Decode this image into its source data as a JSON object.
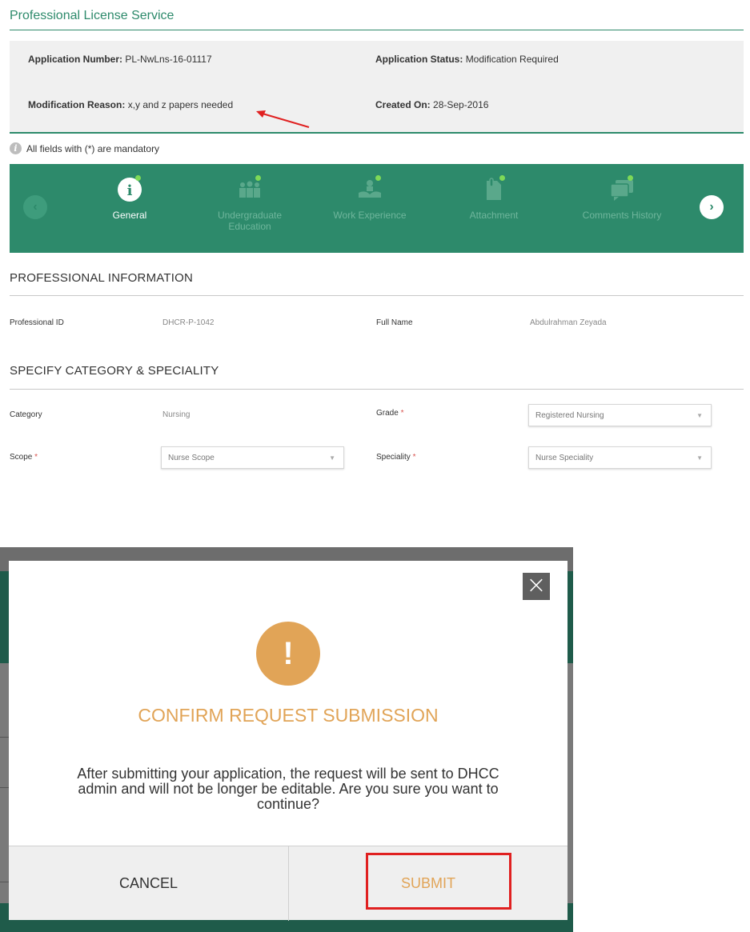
{
  "header": {
    "title": "Professional License Service"
  },
  "application": {
    "number_label": "Application Number:",
    "number_value": "PL-NwLns-16-01117",
    "status_label": "Application Status:",
    "status_value": "Modification Required",
    "reason_label": "Modification Reason:",
    "reason_value": "x,y and z papers needed",
    "created_label": "Created On:",
    "created_value": "28-Sep-2016"
  },
  "mandatory_note": "All fields with (*) are mandatory",
  "steps": [
    {
      "label": "General",
      "icon": "info-icon",
      "active": true
    },
    {
      "label": "Undergraduate Education",
      "icon": "people-icon",
      "active": false
    },
    {
      "label": "Work Experience",
      "icon": "hands-icon",
      "active": false
    },
    {
      "label": "Attachment",
      "icon": "document-icon",
      "active": false
    },
    {
      "label": "Comments History",
      "icon": "comments-icon",
      "active": false
    }
  ],
  "professional_info": {
    "heading": "PROFESSIONAL INFORMATION",
    "id_label": "Professional ID",
    "id_value": "DHCR-P-1042",
    "name_label": "Full Name",
    "name_value": "Abdulrahman Zeyada"
  },
  "category_section": {
    "heading": "SPECIFY CATEGORY & SPECIALITY",
    "category_label": "Category",
    "category_value": "Nursing",
    "grade_label": "Grade",
    "grade_value": "Registered Nursing",
    "scope_label": "Scope",
    "scope_value": "Nurse Scope",
    "speciality_label": "Speciality",
    "speciality_value": "Nurse Speciality",
    "required_mark": "*"
  },
  "modal": {
    "title": "CONFIRM REQUEST SUBMISSION",
    "message": "After submitting your application, the request will be sent to DHCC admin and will not be longer be editable. Are you sure you want to continue?",
    "cancel_label": "CANCEL",
    "submit_label": "SUBMIT",
    "warning_glyph": "!",
    "close_glyph": "×"
  },
  "colors": {
    "brand_green": "#2d8a6b",
    "warning_orange": "#e1a457",
    "highlight_red": "#e02020"
  }
}
